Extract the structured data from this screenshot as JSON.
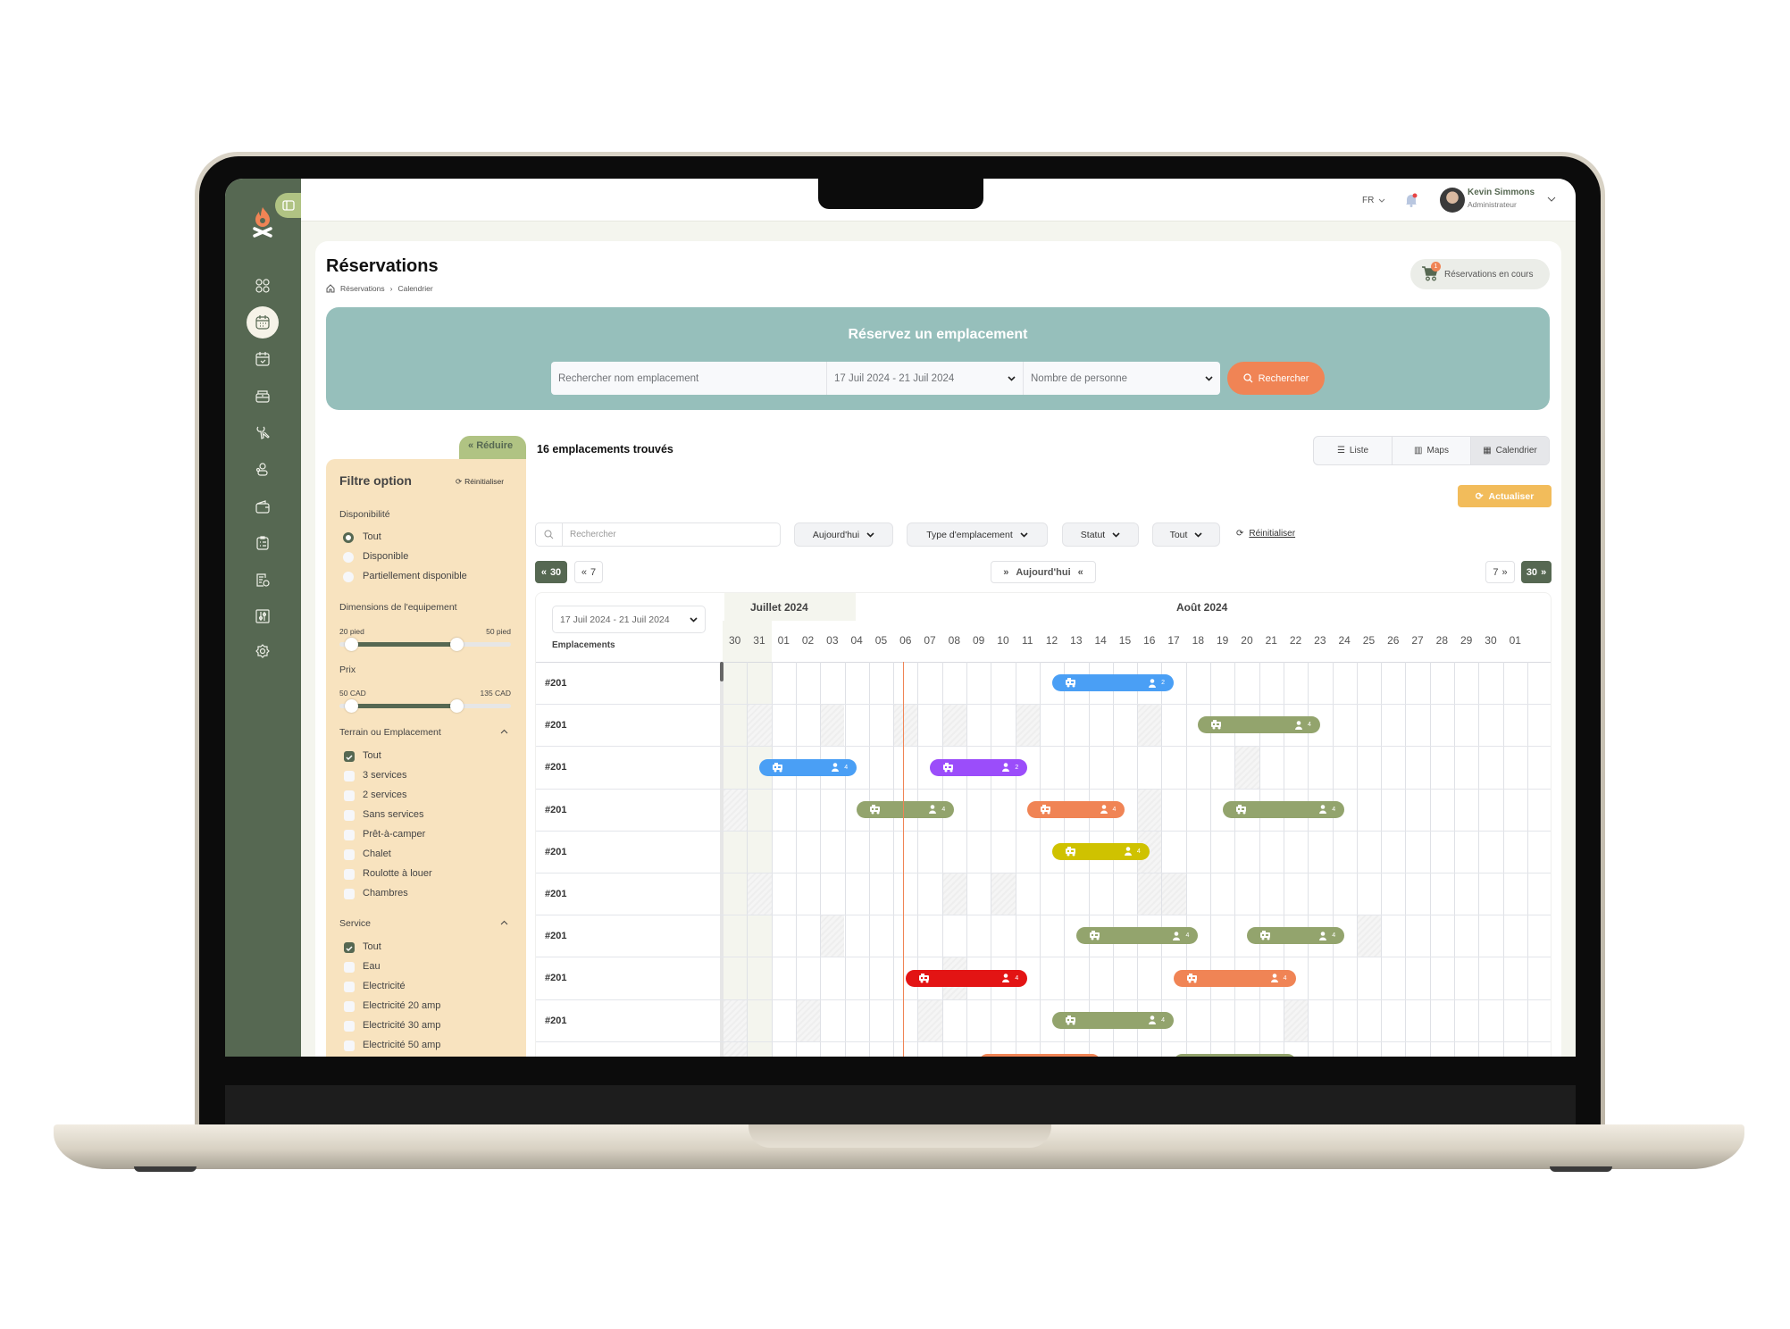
{
  "sidebar": {
    "logo": "campfire-logo",
    "items": [
      {
        "icon": "dashboard-icon"
      },
      {
        "icon": "calendar-icon",
        "active": true
      },
      {
        "icon": "calendar-check-icon"
      },
      {
        "icon": "cash-register-icon"
      },
      {
        "icon": "tools-icon"
      },
      {
        "icon": "users-icon"
      },
      {
        "icon": "wallet-icon"
      },
      {
        "icon": "clipboard-list-icon"
      },
      {
        "icon": "report-clock-icon"
      },
      {
        "icon": "sliders-icon"
      },
      {
        "icon": "settings-icon"
      }
    ]
  },
  "topbar": {
    "language": "FR",
    "notification_dot": true,
    "user": {
      "name": "Kevin Simmons",
      "role": "Administrateur"
    }
  },
  "page": {
    "title": "Réservations",
    "breadcrumb": [
      "Réservations",
      "Calendrier"
    ],
    "cart_badge": "1",
    "cart_label": "Réservations en cours"
  },
  "banner": {
    "title": "Réservez un emplacement",
    "search_placeholder": "Rechercher nom emplacement",
    "date_range": "17 Juil 2024 - 21 Juil 2024",
    "persons_placeholder": "Nombre de personne",
    "search_button": "Rechercher"
  },
  "filters": {
    "collapse_label": "Réduire",
    "title": "Filtre option",
    "reset_label": "Réinitialiser",
    "availability": {
      "label": "Disponibilité",
      "options": [
        "Tout",
        "Disponible",
        "Partiellement disponible"
      ],
      "selected": 0
    },
    "dimensions": {
      "label": "Dimensions de l'equipement",
      "min_label": "20 pied",
      "max_label": "50 pied",
      "selected_fraction": [
        0.07,
        0.68
      ]
    },
    "price": {
      "label": "Prix",
      "min_label": "50 CAD",
      "max_label": "135 CAD",
      "selected_fraction": [
        0.07,
        0.68
      ]
    },
    "terrain": {
      "label": "Terrain ou Emplacement",
      "expanded": true,
      "options": [
        {
          "label": "Tout",
          "checked": true
        },
        {
          "label": "3 services",
          "checked": false
        },
        {
          "label": "2 services",
          "checked": false
        },
        {
          "label": "Sans services",
          "checked": false
        },
        {
          "label": "Prêt-à-camper",
          "checked": false
        },
        {
          "label": "Chalet",
          "checked": false
        },
        {
          "label": "Roulotte à louer",
          "checked": false
        },
        {
          "label": "Chambres",
          "checked": false
        }
      ]
    },
    "service": {
      "label": "Service",
      "expanded": true,
      "options": [
        {
          "label": "Tout",
          "checked": true
        },
        {
          "label": "Eau",
          "checked": false
        },
        {
          "label": "Electricité",
          "checked": false
        },
        {
          "label": "Electricité 20 amp",
          "checked": false
        },
        {
          "label": "Electricité 30 amp",
          "checked": false
        },
        {
          "label": "Electricité 50 amp",
          "checked": false
        }
      ]
    }
  },
  "results": {
    "count_label": "16 emplacements trouvés",
    "views": [
      "Liste",
      "Maps",
      "Calendrier"
    ],
    "active_view": 2,
    "refresh_label": "Actualiser"
  },
  "toolbar": {
    "search_placeholder": "Rechercher",
    "dropdowns": [
      "Aujourd'hui",
      "Type d'emplacement",
      "Statut",
      "Tout"
    ],
    "reset_label": "Réinitialiser"
  },
  "nav": {
    "back30": "30",
    "back7": "7",
    "today": "Aujourd'hui",
    "fwd7": "7",
    "fwd30": "30"
  },
  "colors": {
    "sidebar": "#566852",
    "accent_orange": "#f08455",
    "banner": "#96bfbb",
    "filter_panel": "#f8e3bf",
    "refresh": "#f2bc5b",
    "bar_blue": "#4a9ff5",
    "bar_purple": "#9b4dfa",
    "bar_green": "#93a46d",
    "bar_orange": "#f08455",
    "bar_yellow": "#cfc200",
    "bar_red": "#e31414"
  },
  "calendar": {
    "date_range": "17 Juil 2024 - 21 Juil 2024",
    "column_header": "Emplacements",
    "months": [
      "Juillet 2024",
      "Août 2024"
    ],
    "first_date": "2024-07-30",
    "days": [
      "30",
      "31",
      "01",
      "02",
      "03",
      "04",
      "05",
      "06",
      "07",
      "08",
      "09",
      "10",
      "11",
      "12",
      "13",
      "14",
      "15",
      "16",
      "17",
      "18",
      "19",
      "20",
      "21",
      "22",
      "23",
      "24",
      "25",
      "26",
      "27",
      "28",
      "29",
      "30",
      "01"
    ],
    "today": "2024-08-06",
    "rows": [
      {
        "label": "#201",
        "blocked": [],
        "bars": [
          {
            "start": "2024-08-12",
            "end": "2024-08-17",
            "color": "#4a9ff5",
            "persons": "2"
          }
        ]
      },
      {
        "label": "#201",
        "blocked": [
          "2024-07-31",
          "2024-08-03",
          "2024-08-06",
          "2024-08-08",
          "2024-08-11",
          "2024-08-16"
        ],
        "bars": [
          {
            "start": "2024-08-18",
            "end": "2024-08-23",
            "color": "#93a46d",
            "persons": "4"
          }
        ]
      },
      {
        "label": "#201",
        "blocked": [
          "2024-08-20"
        ],
        "bars": [
          {
            "start": "2024-07-31",
            "end": "2024-08-04",
            "color": "#4a9ff5",
            "persons": "4"
          },
          {
            "start": "2024-08-07",
            "end": "2024-08-11",
            "color": "#9b4dfa",
            "persons": "2"
          }
        ]
      },
      {
        "label": "#201",
        "blocked": [
          "2024-07-30",
          "2024-08-16"
        ],
        "bars": [
          {
            "start": "2024-08-04",
            "end": "2024-08-08",
            "color": "#93a46d",
            "persons": "4"
          },
          {
            "start": "2024-08-11",
            "end": "2024-08-15",
            "color": "#f08455",
            "persons": "4"
          },
          {
            "start": "2024-08-19",
            "end": "2024-08-24",
            "color": "#93a46d",
            "persons": "4"
          }
        ]
      },
      {
        "label": "#201",
        "blocked": [
          "2024-08-16"
        ],
        "bars": [
          {
            "start": "2024-08-12",
            "end": "2024-08-16",
            "color": "#cfc200",
            "persons": "4"
          }
        ]
      },
      {
        "label": "#201",
        "blocked": [
          "2024-07-31",
          "2024-08-08",
          "2024-08-10",
          "2024-08-16",
          "2024-08-17"
        ],
        "bars": []
      },
      {
        "label": "#201",
        "blocked": [
          "2024-08-03",
          "2024-08-25"
        ],
        "bars": [
          {
            "start": "2024-08-13",
            "end": "2024-08-18",
            "color": "#93a46d",
            "persons": "4"
          },
          {
            "start": "2024-08-20",
            "end": "2024-08-24",
            "color": "#93a46d",
            "persons": "4"
          }
        ]
      },
      {
        "label": "#201",
        "blocked": [
          "2024-08-08"
        ],
        "bars": [
          {
            "start": "2024-08-06",
            "end": "2024-08-11",
            "color": "#e31414",
            "persons": "4"
          },
          {
            "start": "2024-08-17",
            "end": "2024-08-22",
            "color": "#f08455",
            "persons": "4"
          }
        ]
      },
      {
        "label": "#201",
        "blocked": [
          "2024-07-30",
          "2024-08-02",
          "2024-08-07",
          "2024-08-22"
        ],
        "bars": [
          {
            "start": "2024-08-12",
            "end": "2024-08-17",
            "color": "#93a46d",
            "persons": "4"
          }
        ]
      },
      {
        "label": "",
        "blocked": [
          "2024-07-30"
        ],
        "bars": [
          {
            "start": "2024-08-09",
            "end": "2024-08-14",
            "color": "#f08455"
          },
          {
            "start": "2024-08-17",
            "end": "2024-08-22",
            "color": "#93a46d"
          }
        ]
      }
    ]
  }
}
